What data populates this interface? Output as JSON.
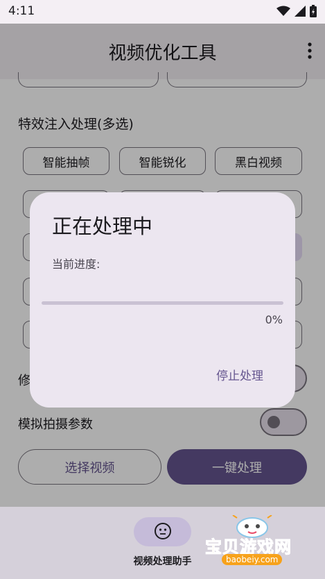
{
  "status_bar": {
    "time": "4:11",
    "icons": [
      "wifi-icon",
      "signal-icon",
      "battery-icon"
    ]
  },
  "app_bar": {
    "title": "视频优化工具",
    "menu_icon": "more-vert-icon"
  },
  "effects": {
    "section_title": "特效注入处理(多选)",
    "chips_row1": [
      "智能抽帧",
      "智能锐化",
      "黑白视频"
    ]
  },
  "settings": {
    "partial_label": "修",
    "simulate_label": "模拟拍摄参数"
  },
  "actions": {
    "select_video": "选择视频",
    "one_click_process": "一键处理"
  },
  "bottom_nav": {
    "item_label": "视频处理助手",
    "item_icon": "face-icon"
  },
  "dialog": {
    "title": "正在处理中",
    "progress_label": "当前进度:",
    "progress_value": 0,
    "progress_text": "0%",
    "stop_button": "停止处理"
  },
  "watermark": {
    "text": "宝贝游戏网",
    "url": "baobeiy.com"
  },
  "colors": {
    "primary": "#65558f",
    "surface": "#f4eff4",
    "dialog_surface": "#ece6f0",
    "outline": "#7a757f"
  }
}
